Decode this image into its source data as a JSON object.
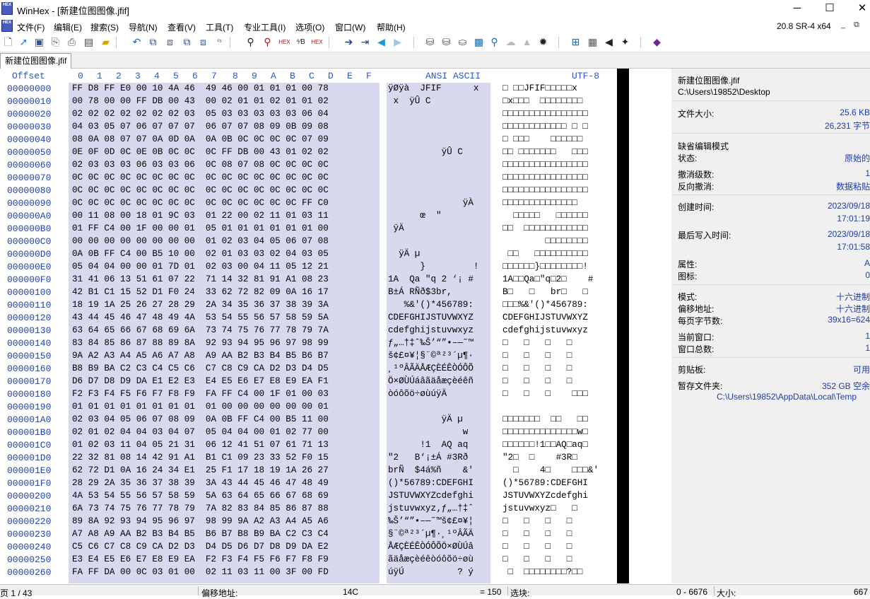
{
  "window": {
    "app_name": "WinHex",
    "title": "WinHex - [新建位图图像.jfif]",
    "logo_text": "HEX",
    "minimize_glyph": "─",
    "maximize_glyph": "☐",
    "close_glyph": "✕"
  },
  "menu": {
    "items": [
      "文件(F)",
      "编辑(E)",
      "搜索(S)",
      "导航(N)",
      "查看(V)",
      "工具(T)",
      "专业工具(I)",
      "选项(O)",
      "窗口(W)",
      "帮助(H)"
    ],
    "version": "20.8 SR-4 x64",
    "mdi_min": "_",
    "mdi_restore": "⧉"
  },
  "toolbar": {
    "icons": [
      "new-file-icon",
      "open-file-icon",
      "save-icon",
      "save-as-icon",
      "print-icon",
      "properties-icon",
      "open-folder-icon",
      "undo-icon",
      "copy-icon",
      "paste-icon",
      "copy-block-icon",
      "clipboard-icon",
      "convert-icon",
      "find-text-icon",
      "find-hex-icon",
      "replace-text-icon",
      "replace-hex-icon",
      "find-hex2-icon",
      "go-to-offset-icon",
      "go-to-bookmark-icon",
      "back-arrow-icon",
      "forward-arrow-icon",
      "open-disk-icon",
      "open-ram-icon",
      "drive-icon",
      "calculator-icon",
      "search-icon",
      "cloud-icon",
      "hash-icon",
      "settings-icon",
      "grid-icon",
      "template-icon",
      "prev-icon",
      "next-icon",
      "help-book-icon"
    ]
  },
  "tab": {
    "label": "新建位图图像.jfif"
  },
  "hex_headers": {
    "offset": "Offset",
    "columns": [
      "0",
      "1",
      "2",
      "3",
      "4",
      "5",
      "6",
      "7",
      "8",
      "9",
      "A",
      "B",
      "C",
      "D",
      "E",
      "F"
    ],
    "ansi": "ANSI ASCII",
    "utf": "UTF-8"
  },
  "rows": [
    {
      "offset": "00000000",
      "hex": "FF D8 FF E0 00 10 4A 46  49 46 00 01 01 01 00 78",
      "ansi": "ÿØÿà  JFIF      x",
      "utf": "□ □□JFIF□□□□□x"
    },
    {
      "offset": "00000010",
      "hex": "00 78 00 00 FF DB 00 43  00 02 01 01 02 01 01 02",
      "ansi": " x  ÿÛ C         ",
      "utf": "□x□□□  □□□□□□□□"
    },
    {
      "offset": "00000020",
      "hex": "02 02 02 02 02 02 02 03  05 03 03 03 03 03 06 04",
      "ansi": "",
      "utf": "□□□□□□□□□□□□□□□□"
    },
    {
      "offset": "00000030",
      "hex": "04 03 05 07 06 07 07 07  06 07 07 08 09 0B 09 08",
      "ansi": "",
      "utf": "□□□□□□□□□□□□ □ □"
    },
    {
      "offset": "00000040",
      "hex": "08 0A 08 07 07 0A 0D 0A  0A 0B 0C 0C 0C 0C 07 09",
      "ansi": "",
      "utf": "□ □□□    □□□□□□"
    },
    {
      "offset": "00000050",
      "hex": "0E 0F 0D 0C 0E 0B 0C 0C  0C FF DB 00 43 01 02 02",
      "ansi": "          ÿÛ C   ",
      "utf": "□□ □□□□□□□   □□□"
    },
    {
      "offset": "00000060",
      "hex": "02 03 03 03 06 03 03 06  0C 08 07 08 0C 0C 0C 0C",
      "ansi": "",
      "utf": "□□□□□□□□□□□□□□□□"
    },
    {
      "offset": "00000070",
      "hex": "0C 0C 0C 0C 0C 0C 0C 0C  0C 0C 0C 0C 0C 0C 0C 0C",
      "ansi": "",
      "utf": "□□□□□□□□□□□□□□□□"
    },
    {
      "offset": "00000080",
      "hex": "0C 0C 0C 0C 0C 0C 0C 0C  0C 0C 0C 0C 0C 0C 0C 0C",
      "ansi": "",
      "utf": "□□□□□□□□□□□□□□□□"
    },
    {
      "offset": "00000090",
      "hex": "0C 0C 0C 0C 0C 0C 0C 0C  0C 0C 0C 0C 0C 0C FF C0",
      "ansi": "              ÿÀ",
      "utf": "□□□□□□□□□□□□□□"
    },
    {
      "offset": "000000A0",
      "hex": "00 11 08 00 18 01 9C 03  01 22 00 02 11 01 03 11",
      "ansi": "      œ  \"       ",
      "utf": "  □□□□□   □□□□□□"
    },
    {
      "offset": "000000B0",
      "hex": "01 FF C4 00 1F 00 00 01  05 01 01 01 01 01 01 00",
      "ansi": " ÿÄ              ",
      "utf": "□□  □□□□□□□□□□□□"
    },
    {
      "offset": "000000C0",
      "hex": "00 00 00 00 00 00 00 00  01 02 03 04 05 06 07 08",
      "ansi": "",
      "utf": "        □□□□□□□□"
    },
    {
      "offset": "000000D0",
      "hex": "0A 0B FF C4 00 B5 10 00  02 01 03 03 02 04 03 05",
      "ansi": "  ÿÄ µ          ",
      "utf": " □□   □□□□□□□□□□"
    },
    {
      "offset": "000000E0",
      "hex": "05 04 04 00 00 01 7D 01  02 03 00 04 11 05 12 21",
      "ansi": "      }         !",
      "utf": "□□□□□□}□□□□□□□□!"
    },
    {
      "offset": "000000F0",
      "hex": "31 41 06 13 51 61 07 22  71 14 32 81 91 A1 08 23",
      "ansi": "1A  Qa \"q 2 ‘¡ #",
      "utf": "1A□□Qa□\"q□2□    #"
    },
    {
      "offset": "00000100",
      "hex": "42 B1 C1 15 52 D1 F0 24  33 62 72 82 09 0A 16 17",
      "ansi": "B±Á RÑð$3br,    ",
      "utf": "B□   □   br□   □"
    },
    {
      "offset": "00000110",
      "hex": "18 19 1A 25 26 27 28 29  2A 34 35 36 37 38 39 3A",
      "ansi": "   %&'()*456789:",
      "utf": "□□□%&'()*456789:"
    },
    {
      "offset": "00000120",
      "hex": "43 44 45 46 47 48 49 4A  53 54 55 56 57 58 59 5A",
      "ansi": "CDEFGHIJSTUVWXYZ",
      "utf": "CDEFGHIJSTUVWXYZ"
    },
    {
      "offset": "00000130",
      "hex": "63 64 65 66 67 68 69 6A  73 74 75 76 77 78 79 7A",
      "ansi": "cdefghijstuvwxyz",
      "utf": "cdefghijstuvwxyz"
    },
    {
      "offset": "00000140",
      "hex": "83 84 85 86 87 88 89 8A  92 93 94 95 96 97 98 99",
      "ansi": "ƒ„…†‡ˆ‰Š’“”•–—˜™",
      "utf": "□   □   □   □"
    },
    {
      "offset": "00000150",
      "hex": "9A A2 A3 A4 A5 A6 A7 A8  A9 AA B2 B3 B4 B5 B6 B7",
      "ansi": "š¢£¤¥¦§¨©ª²³´µ¶·",
      "utf": "□   □   □   □"
    },
    {
      "offset": "00000160",
      "hex": "B8 B9 BA C2 C3 C4 C5 C6  C7 C8 C9 CA D2 D3 D4 D5",
      "ansi": "¸¹ºÂÃÄÅÆÇÈÉÊÒÓÔÕ",
      "utf": "□   □   □   □"
    },
    {
      "offset": "00000170",
      "hex": "D6 D7 D8 D9 DA E1 E2 E3  E4 E5 E6 E7 E8 E9 EA F1",
      "ansi": "Ö×ØÙÚáâãäåæçèéêñ",
      "utf": "□   □   □   □"
    },
    {
      "offset": "00000180",
      "hex": "F2 F3 F4 F5 F6 F7 F8 F9  FA FF C4 00 1F 01 00 03",
      "ansi": "òóôõö÷øùúÿÄ      ",
      "utf": "□   □   □    □□□"
    },
    {
      "offset": "00000190",
      "hex": "01 01 01 01 01 01 01 01  01 00 00 00 00 00 00 01",
      "ansi": "",
      "utf": ""
    },
    {
      "offset": "000001A0",
      "hex": "02 03 04 05 06 07 08 09  0A 0B FF C4 00 B5 11 00",
      "ansi": "          ÿÄ µ  ",
      "utf": "□□□□□□□  □□   □□"
    },
    {
      "offset": "000001B0",
      "hex": "02 01 02 04 04 03 04 07  05 04 04 00 01 02 77 00",
      "ansi": "              w ",
      "utf": "□□□□□□□□□□□□□□w□"
    },
    {
      "offset": "000001C0",
      "hex": "01 02 03 11 04 05 21 31  06 12 41 51 07 61 71 13",
      "ansi": "      !1  AQ aq ",
      "utf": "□□□□□□!1□□AQ□aq□"
    },
    {
      "offset": "000001D0",
      "hex": "22 32 81 08 14 42 91 A1  B1 C1 09 23 33 52 F0 15",
      "ansi": "\"2   B‘¡±Á #3Rð ",
      "utf": "\"2□  □    #3R□"
    },
    {
      "offset": "000001E0",
      "hex": "62 72 D1 0A 16 24 34 E1  25 F1 17 18 19 1A 26 27",
      "ansi": "brÑ  $4á%ñ    &'",
      "utf": "  □    4□    □□□&'"
    },
    {
      "offset": "000001F0",
      "hex": "28 29 2A 35 36 37 38 39  3A 43 44 45 46 47 48 49",
      "ansi": "()*56789:CDEFGHI",
      "utf": "()*56789:CDEFGHI"
    },
    {
      "offset": "00000200",
      "hex": "4A 53 54 55 56 57 58 59  5A 63 64 65 66 67 68 69",
      "ansi": "JSTUVWXYZcdefghi",
      "utf": "JSTUVWXYZcdefghi"
    },
    {
      "offset": "00000210",
      "hex": "6A 73 74 75 76 77 78 79  7A 82 83 84 85 86 87 88",
      "ansi": "jstuvwxyz‚ƒ„…†‡ˆ",
      "utf": "jstuvwxyz□   □"
    },
    {
      "offset": "00000220",
      "hex": "89 8A 92 93 94 95 96 97  98 99 9A A2 A3 A4 A5 A6",
      "ansi": "‰Š’“”•–—˜™š¢£¤¥¦",
      "utf": "□   □   □   □"
    },
    {
      "offset": "00000230",
      "hex": "A7 A8 A9 AA B2 B3 B4 B5  B6 B7 B8 B9 BA C2 C3 C4",
      "ansi": "§¨©ª²³´µ¶·¸¹ºÂÃÄ",
      "utf": "□   □   □   □"
    },
    {
      "offset": "00000240",
      "hex": "C5 C6 C7 C8 C9 CA D2 D3  D4 D5 D6 D7 D8 D9 DA E2",
      "ansi": "ÅÆÇÈÉÊÒÓÔÕÖ×ØÙÚâ",
      "utf": "□   □   □   □"
    },
    {
      "offset": "00000250",
      "hex": "E3 E4 E5 E6 E7 E8 E9 EA  F2 F3 F4 F5 F6 F7 F8 F9",
      "ansi": "ãäåæçèéêòóôõö÷øù",
      "utf": "□   □   □   □"
    },
    {
      "offset": "00000260",
      "hex": "FA FF DA 00 0C 03 01 00  02 11 03 11 00 3F 00 FD",
      "ansi": "úÿÚ          ? ý",
      "utf": " □  □□□□□□□□?□□"
    }
  ],
  "info_panel": {
    "file_name": "新建位图图像.jfif",
    "file_path": "C:\\Users\\19852\\Desktop",
    "file_size_label": "文件大小:",
    "file_size_kb": "25.6 KB",
    "file_size_bytes": "26,231 字节",
    "default_edit_mode": "缺省编辑模式",
    "state_label": "状态:",
    "state_value": "原始的",
    "undo_level_label": "撤消级数:",
    "undo_level_value": "1",
    "reverse_undo_label": "反向撤消:",
    "reverse_undo_value": "数据粘贴",
    "created_label": "创建时间:",
    "created_date": "2023/09/18",
    "created_time": "17:01:19",
    "modified_label": "最后写入时间:",
    "modified_date": "2023/09/18",
    "modified_time": "17:01:58",
    "attr_label": "属性:",
    "attr_value": "A",
    "icon_label": "图标:",
    "icon_value": "0",
    "mode_label": "模式:",
    "mode_value": "十六进制",
    "offset_addr_label": "偏移地址:",
    "offset_addr_value": "十六进制",
    "bytes_per_page_label": "每页字节数:",
    "bytes_per_page_value": "39x16=624",
    "current_window_label": "当前窗口:",
    "current_window_value": "1",
    "total_windows_label": "窗口总数:",
    "total_windows_value": "1",
    "clipboard_label": "剪贴板:",
    "clipboard_value": "可用",
    "temp_folder_label": "暂存文件夹:",
    "temp_folder_space": "352 GB 空余",
    "temp_folder_path": "C:\\Users\\19852\\AppData\\Local\\Temp"
  },
  "statusbar": {
    "page": "页 1 / 43",
    "offset_label": "偏移地址:",
    "offset_value": "14C",
    "value_text": "= 150",
    "selection_label": "选块:",
    "selection_range": "0 - 6676",
    "size_label": "大小:",
    "size_value": "667"
  },
  "colors": {
    "hex_bg": "#d8d8ee",
    "offset_fg": "#2242b4",
    "header_fg": "#2c55c8",
    "info_value_fg": "#1f3da6"
  }
}
